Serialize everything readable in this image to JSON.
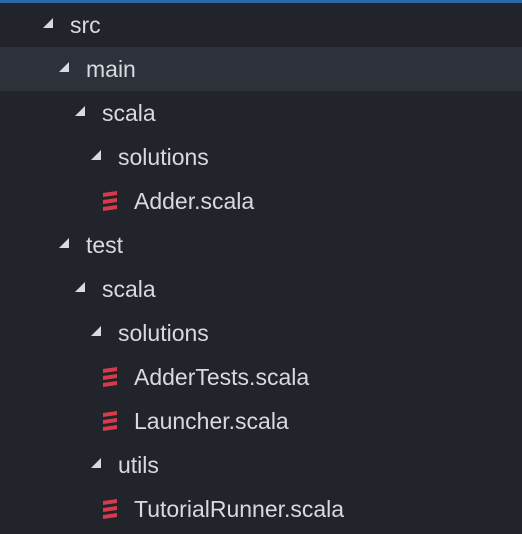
{
  "colors": {
    "background": "#21252b",
    "selected_row": "#2c313a",
    "text": "#d7dae0",
    "scala_icon": "#d83a4b",
    "focus_border": "#2b6aa8"
  },
  "tree": {
    "items": [
      {
        "label": "src",
        "type": "folder",
        "expanded": true,
        "icon": "expand-arrow-icon"
      },
      {
        "label": "main",
        "type": "folder",
        "expanded": true,
        "icon": "expand-arrow-icon"
      },
      {
        "label": "scala",
        "type": "folder",
        "expanded": true,
        "icon": "expand-arrow-icon"
      },
      {
        "label": "solutions",
        "type": "folder",
        "expanded": true,
        "icon": "expand-arrow-icon"
      },
      {
        "label": "Adder.scala",
        "type": "file",
        "icon": "scala-file-icon"
      },
      {
        "label": "test",
        "type": "folder",
        "expanded": true,
        "icon": "expand-arrow-icon"
      },
      {
        "label": "scala",
        "type": "folder",
        "expanded": true,
        "icon": "expand-arrow-icon"
      },
      {
        "label": "solutions",
        "type": "folder",
        "expanded": true,
        "icon": "expand-arrow-icon"
      },
      {
        "label": "AdderTests.scala",
        "type": "file",
        "icon": "scala-file-icon"
      },
      {
        "label": "Launcher.scala",
        "type": "file",
        "icon": "scala-file-icon"
      },
      {
        "label": "utils",
        "type": "folder",
        "expanded": true,
        "icon": "expand-arrow-icon"
      },
      {
        "label": "TutorialRunner.scala",
        "type": "file",
        "icon": "scala-file-icon"
      }
    ]
  }
}
